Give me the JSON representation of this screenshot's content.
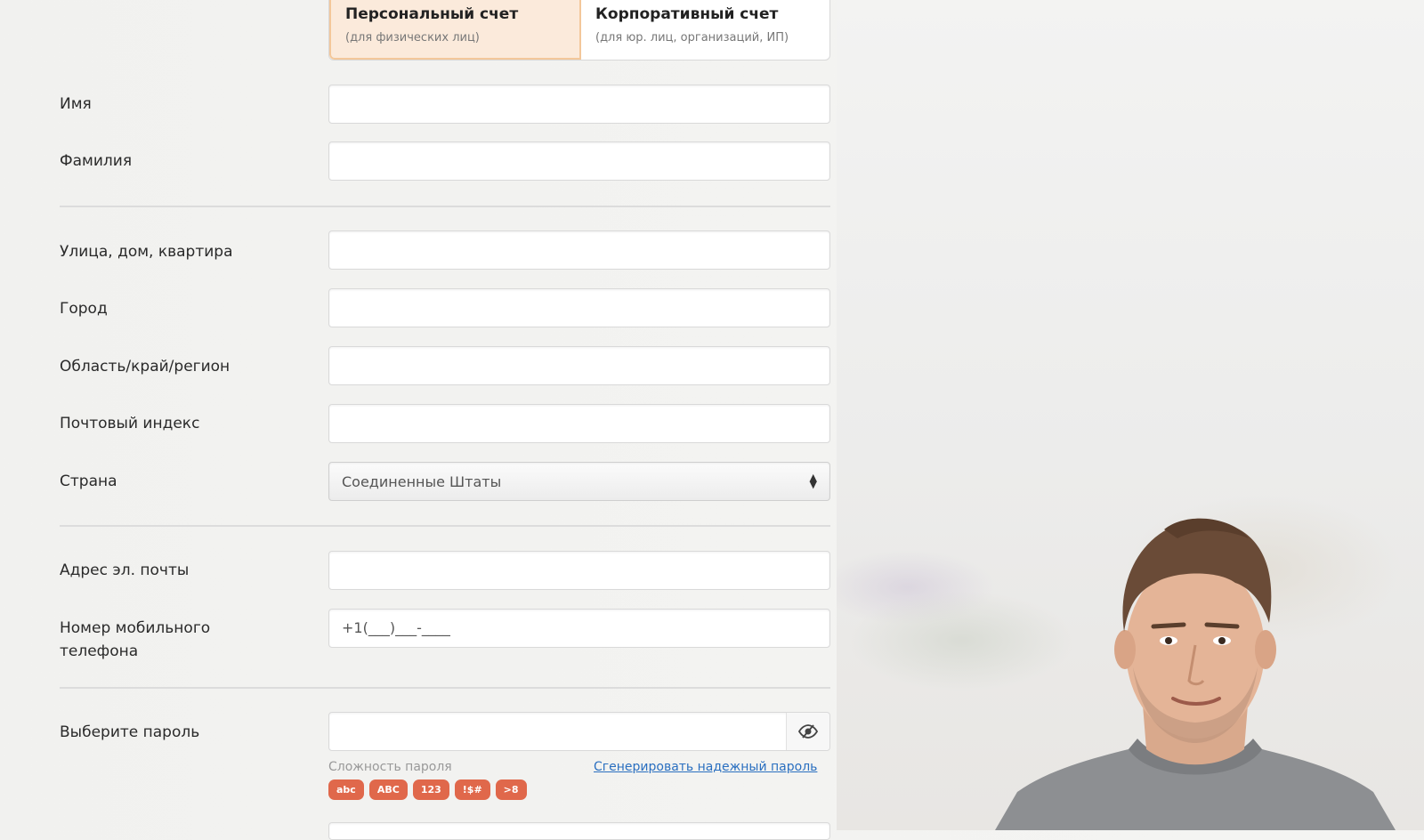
{
  "tabs": [
    {
      "title": "Персональный счет",
      "subtitle": "(для физических лиц)",
      "active": true
    },
    {
      "title": "Корпоративный счет",
      "subtitle": "(для юр. лиц, организаций, ИП)",
      "active": false
    }
  ],
  "form": {
    "first_name_label": "Имя",
    "last_name_label": "Фамилия",
    "street_label": "Улица, дом, квартира",
    "city_label": "Город",
    "region_label": "Область/край/регион",
    "zip_label": "Почтовый индекс",
    "country_label": "Страна",
    "country_value": "Соединенные Штаты",
    "email_label": "Адрес эл. почты",
    "phone_label_line1": "Номер мобильного",
    "phone_label_line2": "телефона",
    "phone_value": "+1(___)___-____",
    "password_label": "Выберите пароль",
    "password_strength_label": "Сложность пароля",
    "generate_password_link": "Сгенерировать надежный пароль",
    "strength_badges": [
      "abc",
      "ABC",
      "123",
      "!$#",
      ">8"
    ]
  },
  "colors": {
    "accent": "#e0684b",
    "active_tab_bg": "#fbeadb",
    "link": "#2a6fc0"
  }
}
